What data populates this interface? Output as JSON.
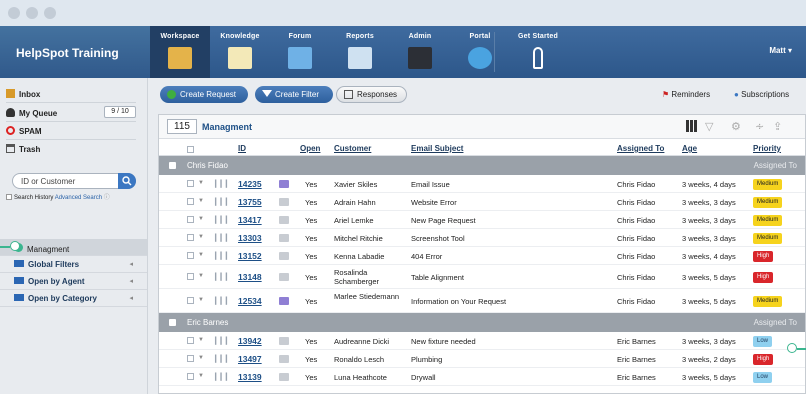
{
  "app": {
    "brand": "HelpSpot Training",
    "user_menu": "Matt ▾"
  },
  "nav": {
    "tabs": [
      {
        "label": "Workspace",
        "icon": "workspace-icon",
        "active": true
      },
      {
        "label": "Knowledge",
        "icon": "knowledge-icon",
        "active": false
      },
      {
        "label": "Forum",
        "icon": "forum-icon",
        "active": false
      },
      {
        "label": "Reports",
        "icon": "reports-icon",
        "active": false
      },
      {
        "label": "Admin",
        "icon": "admin-icon",
        "active": false
      },
      {
        "label": "Portal",
        "icon": "portal-icon",
        "active": false
      },
      {
        "label": "Get Started",
        "icon": "pointer-icon",
        "active": false
      }
    ]
  },
  "sidebar": {
    "inbox": "Inbox",
    "my_queue": "My Queue",
    "my_queue_count": "9 / 10",
    "spam": "SPAM",
    "trash": "Trash",
    "search_placeholder": "ID or Customer",
    "search_history": "Search History",
    "advanced_search": "Advanced Search",
    "filters": [
      {
        "label": "Managment",
        "selected": true
      },
      {
        "label": "Global Filters",
        "selected": false
      },
      {
        "label": "Open by Agent",
        "selected": false
      },
      {
        "label": "Open by Category",
        "selected": false
      }
    ]
  },
  "toolbar": {
    "create_request": "Create Request",
    "create_filter": "Create Filter",
    "responses": "Responses",
    "reminders": "Reminders",
    "subscriptions": "Subscriptions"
  },
  "panel": {
    "count": "115",
    "title": "Managment"
  },
  "columns": {
    "id": "ID",
    "open": "Open",
    "customer": "Customer",
    "email_subject": "Email Subject",
    "assigned_to": "Assigned To",
    "age": "Age",
    "priority": "Priority"
  },
  "groups": [
    {
      "name": "Chris Fidao",
      "assigned_to_label": "Assigned To",
      "rows": [
        {
          "id": "14235",
          "source": "web",
          "open": "Yes",
          "customer": "Xavier Skiles",
          "subject": "Email Issue",
          "assigned": "Chris Fidao",
          "age": "3 weeks, 4 days",
          "priority": "Medium"
        },
        {
          "id": "13755",
          "source": "email",
          "open": "Yes",
          "customer": "Adrain Hahn",
          "subject": "Website Error",
          "assigned": "Chris Fidao",
          "age": "3 weeks, 3 days",
          "priority": "Medium"
        },
        {
          "id": "13417",
          "source": "email",
          "open": "Yes",
          "customer": "Ariel Lemke",
          "subject": "New Page Request",
          "assigned": "Chris Fidao",
          "age": "3 weeks, 3 days",
          "priority": "Medium"
        },
        {
          "id": "13303",
          "source": "email",
          "open": "Yes",
          "customer": "Mitchel Ritchie",
          "subject": "Screenshot Tool",
          "assigned": "Chris Fidao",
          "age": "3 weeks, 3 days",
          "priority": "Medium"
        },
        {
          "id": "13152",
          "source": "email",
          "open": "Yes",
          "customer": "Kenna Labadie",
          "subject": "404 Error",
          "assigned": "Chris Fidao",
          "age": "3 weeks, 4 days",
          "priority": "High"
        },
        {
          "id": "13148",
          "source": "email",
          "open": "Yes",
          "customer": "Rosalinda Schamberger",
          "subject": "Table Alignment",
          "assigned": "Chris Fidao",
          "age": "3 weeks, 5 days",
          "priority": "High"
        },
        {
          "id": "12534",
          "source": "web",
          "open": "Yes",
          "customer": "Marlee Stiedemann",
          "subject": "Information on Your Request",
          "assigned": "Chris Fidao",
          "age": "3 weeks, 5 days",
          "priority": "Medium"
        }
      ]
    },
    {
      "name": "Eric Barnes",
      "assigned_to_label": "Assigned To",
      "rows": [
        {
          "id": "13942",
          "source": "email",
          "open": "Yes",
          "customer": "Audreanne Dicki",
          "subject": "New fixture needed",
          "assigned": "Eric Barnes",
          "age": "3 weeks, 3 days",
          "priority": "Low"
        },
        {
          "id": "13497",
          "source": "email",
          "open": "Yes",
          "customer": "Ronaldo Lesch",
          "subject": "Plumbing",
          "assigned": "Eric Barnes",
          "age": "3 weeks, 2 days",
          "priority": "High"
        },
        {
          "id": "13139",
          "source": "email",
          "open": "Yes",
          "customer": "Luna Heathcote",
          "subject": "Drywall",
          "assigned": "Eric Barnes",
          "age": "3 weeks, 5 days",
          "priority": "Low"
        }
      ]
    }
  ],
  "colors": {
    "header": "#2d578a",
    "accent": "#1d4f86",
    "medium": "#f6d31d",
    "high": "#d9262b",
    "low": "#8fd0ef",
    "annotation": "#3bb58f"
  }
}
